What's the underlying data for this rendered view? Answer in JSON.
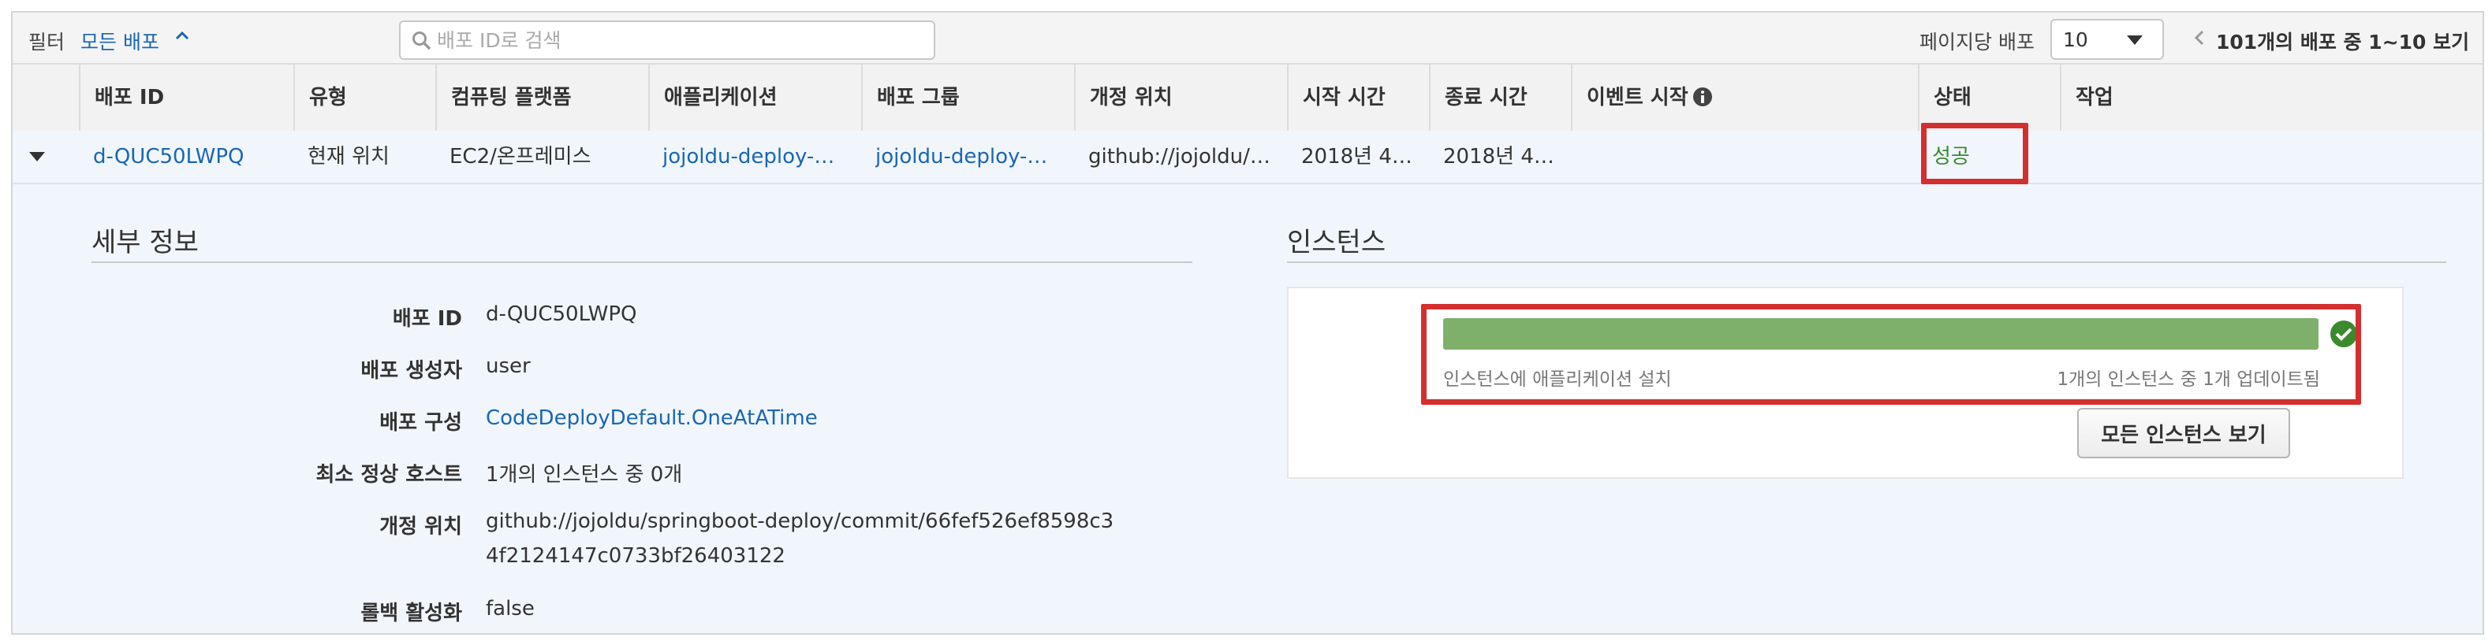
{
  "toolbar": {
    "filter_label": "필터",
    "filter_value": "모든 배포",
    "search_placeholder": "배포 ID로 검색",
    "per_page_label": "페이지당 배포",
    "per_page_value": "10",
    "pager_summary": "101개의 배포 중 1~10 보기"
  },
  "table": {
    "columns": [
      "배포 ID",
      "유형",
      "컴퓨팅 플랫폼",
      "애플리케이션",
      "배포 그룹",
      "개정 위치",
      "시작 시간",
      "종료 시간",
      "이벤트 시작",
      "상태",
      "작업"
    ],
    "row": {
      "deployment_id": "d-QUC50LWPQ",
      "type": "현재 위치",
      "platform": "EC2/온프레미스",
      "application": "jojoldu-deploy-…",
      "group": "jojoldu-deploy-…",
      "revision": "github://jojoldu/…",
      "start_time": "2018년 4…",
      "end_time": "2018년 4…",
      "event_start": "",
      "status": "성공",
      "action": ""
    }
  },
  "details": {
    "title": "세부 정보",
    "items": [
      {
        "label": "배포 ID",
        "value": "d-QUC50LWPQ"
      },
      {
        "label": "배포 생성자",
        "value": "user"
      },
      {
        "label": "배포 구성",
        "value": "CodeDeployDefault.OneAtATime"
      },
      {
        "label": "최소 정상 호스트",
        "value": "1개의 인스턴스 중 0개"
      },
      {
        "label": "개정 위치",
        "value": "github://jojoldu/springboot-deploy/commit/66fef526ef8598c34f2124147c0733bf26403122"
      },
      {
        "label": "롤백 활성화",
        "value": "false"
      }
    ]
  },
  "instances": {
    "title": "인스턴스",
    "progress_percent": 100,
    "progress_label_left": "인스턴스에 애플리케이션 설치",
    "progress_label_right": "1개의 인스턴스 중 1개 업데이트됨",
    "view_all_button": "모든 인스턴스 보기"
  },
  "colors": {
    "link": "#1a66b3",
    "success": "#3b8a2e",
    "progress": "#7eb06c",
    "highlight": "#d32f2f",
    "row_bg": "#f1f6fc"
  },
  "icons": {
    "search": "search-icon",
    "filter_toggle": "chevron-up-icon",
    "per_page_caret": "caret-down-icon",
    "pager_prev": "chevron-left-icon",
    "row_expand": "caret-down-icon",
    "info": "info-icon",
    "complete": "check-circle-icon"
  }
}
